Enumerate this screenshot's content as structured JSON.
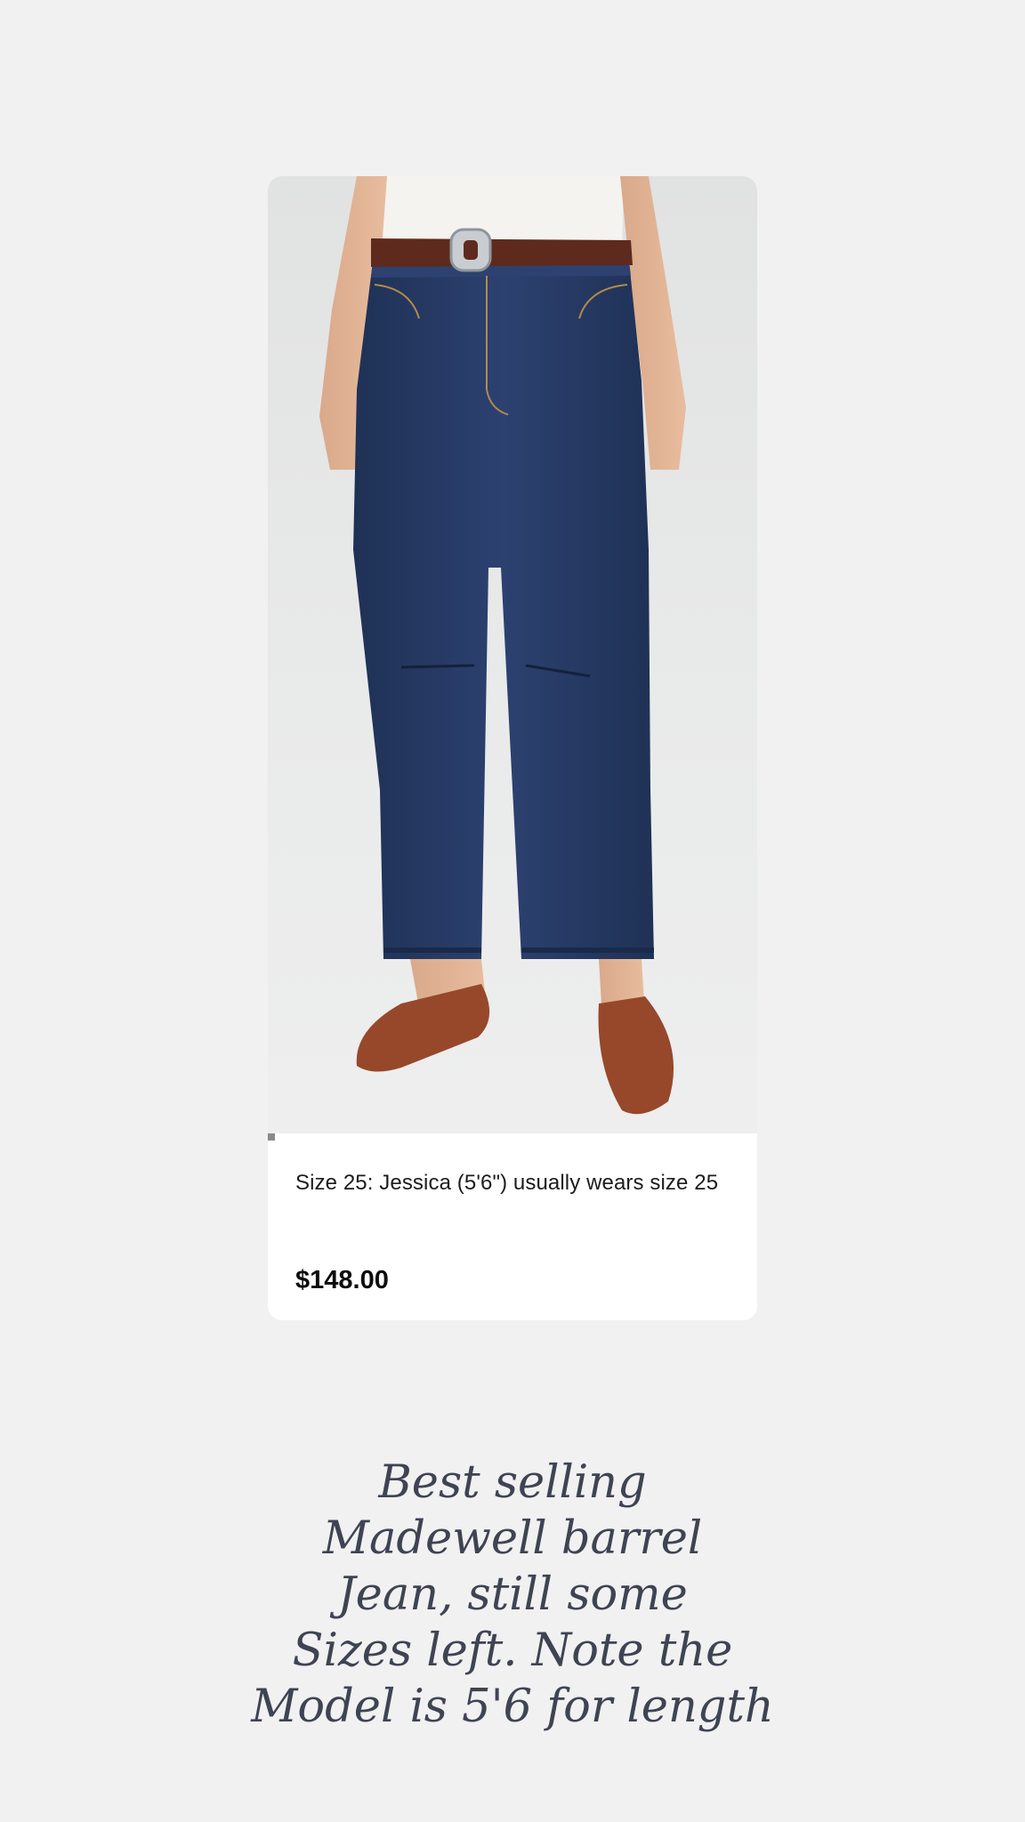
{
  "product": {
    "image_alt": "Model wearing dark wash barrel jeans with brown belt and suede flats",
    "image_progress": 0.015,
    "fit_note": "Size 25: Jessica (5'6\") usually wears size 25",
    "price": "$148.00"
  },
  "caption": {
    "lines": [
      "Best selling",
      "Madewell barrel",
      "Jean, still some",
      "Sizes left. Note the",
      "Model is 5'6 for length"
    ]
  },
  "colors": {
    "background": "#f1f1f1",
    "card": "#ffffff",
    "denim": "#283b62",
    "belt": "#5e2a1e",
    "shoes": "#97482a",
    "caption_text": "#3e4453"
  }
}
